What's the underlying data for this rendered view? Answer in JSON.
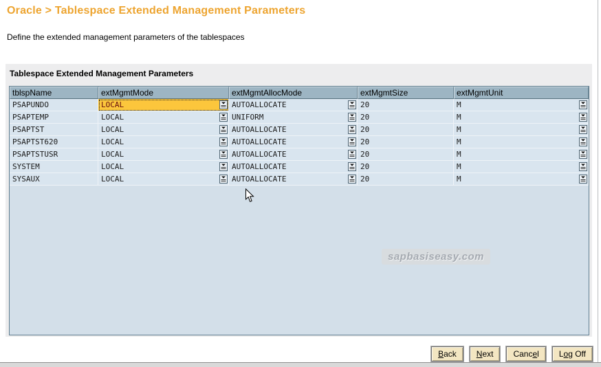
{
  "page": {
    "title": "Oracle > Tablespace Extended Management Parameters",
    "subtitle": "Define the extended management parameters of the tablespaces"
  },
  "panel": {
    "section_title": "Tablespace Extended Management Parameters"
  },
  "table": {
    "columns": [
      "tblspName",
      "extMgmtMode",
      "extMgmtAllocMode",
      "extMgmtSize",
      "extMgmtUnit"
    ],
    "rows": [
      {
        "tblspName": "PSAPUNDO",
        "extMgmtMode": "LOCAL",
        "extMgmtAllocMode": "AUTOALLOCATE",
        "extMgmtSize": "20",
        "extMgmtUnit": "M",
        "focused": true
      },
      {
        "tblspName": "PSAPTEMP",
        "extMgmtMode": "LOCAL",
        "extMgmtAllocMode": "UNIFORM",
        "extMgmtSize": "20",
        "extMgmtUnit": "M",
        "focused": false
      },
      {
        "tblspName": "PSAPTST",
        "extMgmtMode": "LOCAL",
        "extMgmtAllocMode": "AUTOALLOCATE",
        "extMgmtSize": "20",
        "extMgmtUnit": "M",
        "focused": false
      },
      {
        "tblspName": "PSAPTST620",
        "extMgmtMode": "LOCAL",
        "extMgmtAllocMode": "AUTOALLOCATE",
        "extMgmtSize": "20",
        "extMgmtUnit": "M",
        "focused": false
      },
      {
        "tblspName": "PSAPTSTUSR",
        "extMgmtMode": "LOCAL",
        "extMgmtAllocMode": "AUTOALLOCATE",
        "extMgmtSize": "20",
        "extMgmtUnit": "M",
        "focused": false
      },
      {
        "tblspName": "SYSTEM",
        "extMgmtMode": "LOCAL",
        "extMgmtAllocMode": "AUTOALLOCATE",
        "extMgmtSize": "20",
        "extMgmtUnit": "M",
        "focused": false
      },
      {
        "tblspName": "SYSAUX",
        "extMgmtMode": "LOCAL",
        "extMgmtAllocMode": "AUTOALLOCATE",
        "extMgmtSize": "20",
        "extMgmtUnit": "M",
        "focused": false
      }
    ]
  },
  "buttons": [
    {
      "name": "back-button",
      "label": "Back",
      "underline_index": 0
    },
    {
      "name": "next-button",
      "label": "Next",
      "underline_index": 0
    },
    {
      "name": "cancel-button",
      "label": "Cancel",
      "underline_index": 4
    },
    {
      "name": "logoff-button",
      "label": "Log Off",
      "underline_index": 1
    }
  ],
  "watermark": "sapbasiseasy.com",
  "icons": {
    "dropdown": "dropdown-list-icon",
    "cursor": "mouse-arrow-cursor"
  },
  "colors": {
    "title_orange": "#eda42f",
    "panel_bg": "#ededee",
    "table_header_bg": "#9db5c3",
    "row_bg": "#d9e5ef",
    "table_filler_bg": "#d3dfe9",
    "focus_bg": "#fcc63c",
    "focus_text": "#650d0d",
    "button_bg": "#f3e6c2"
  }
}
